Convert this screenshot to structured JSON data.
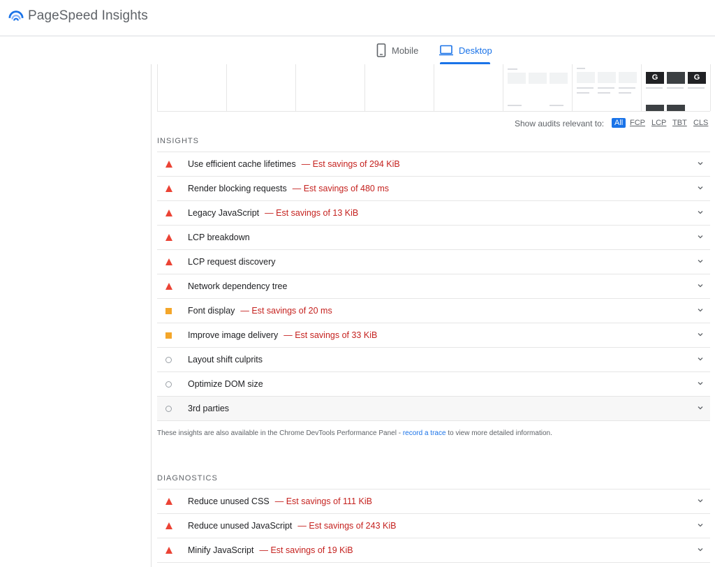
{
  "app": {
    "title": "PageSpeed Insights"
  },
  "tabs": [
    {
      "label": "Mobile",
      "icon": "phone-icon"
    },
    {
      "label": "Desktop",
      "icon": "laptop-icon",
      "active": true
    }
  ],
  "filter": {
    "label": "Show audits relevant to:",
    "chips": [
      "All",
      "FCP",
      "LCP",
      "TBT",
      "CLS"
    ],
    "active": "All"
  },
  "insights": {
    "title": "INSIGHTS",
    "items": [
      {
        "severity": "fail",
        "title": "Use efficient cache lifetimes",
        "savings": "— Est savings of 294 KiB"
      },
      {
        "severity": "fail",
        "title": "Render blocking requests",
        "savings": "— Est savings of 480 ms"
      },
      {
        "severity": "fail",
        "title": "Legacy JavaScript",
        "savings": "— Est savings of 13 KiB"
      },
      {
        "severity": "fail",
        "title": "LCP breakdown",
        "savings": ""
      },
      {
        "severity": "fail",
        "title": "LCP request discovery",
        "savings": ""
      },
      {
        "severity": "fail",
        "title": "Network dependency tree",
        "savings": ""
      },
      {
        "severity": "average",
        "title": "Font display",
        "savings": "— Est savings of 20 ms"
      },
      {
        "severity": "average",
        "title": "Improve image delivery",
        "savings": "— Est savings of 33 KiB"
      },
      {
        "severity": "info",
        "title": "Layout shift culprits",
        "savings": ""
      },
      {
        "severity": "info",
        "title": "Optimize DOM size",
        "savings": ""
      },
      {
        "severity": "info",
        "title": "3rd parties",
        "savings": ""
      }
    ],
    "note_prefix": "These insights are also available in the Chrome DevTools Performance Panel - ",
    "note_link": "record a trace",
    "note_suffix": " to view more detailed information."
  },
  "diagnostics": {
    "title": "DIAGNOSTICS",
    "items": [
      {
        "severity": "fail",
        "title": "Reduce unused CSS",
        "savings": "— Est savings of 111 KiB"
      },
      {
        "severity": "fail",
        "title": "Reduce unused JavaScript",
        "savings": "— Est savings of 243 KiB"
      },
      {
        "severity": "fail",
        "title": "Minify JavaScript",
        "savings": "— Est savings of 19 KiB"
      }
    ]
  },
  "colors": {
    "accent": "#1a73e8",
    "fail": "#eb4335",
    "average": "#f4a62a",
    "savings": "#c5221f"
  }
}
